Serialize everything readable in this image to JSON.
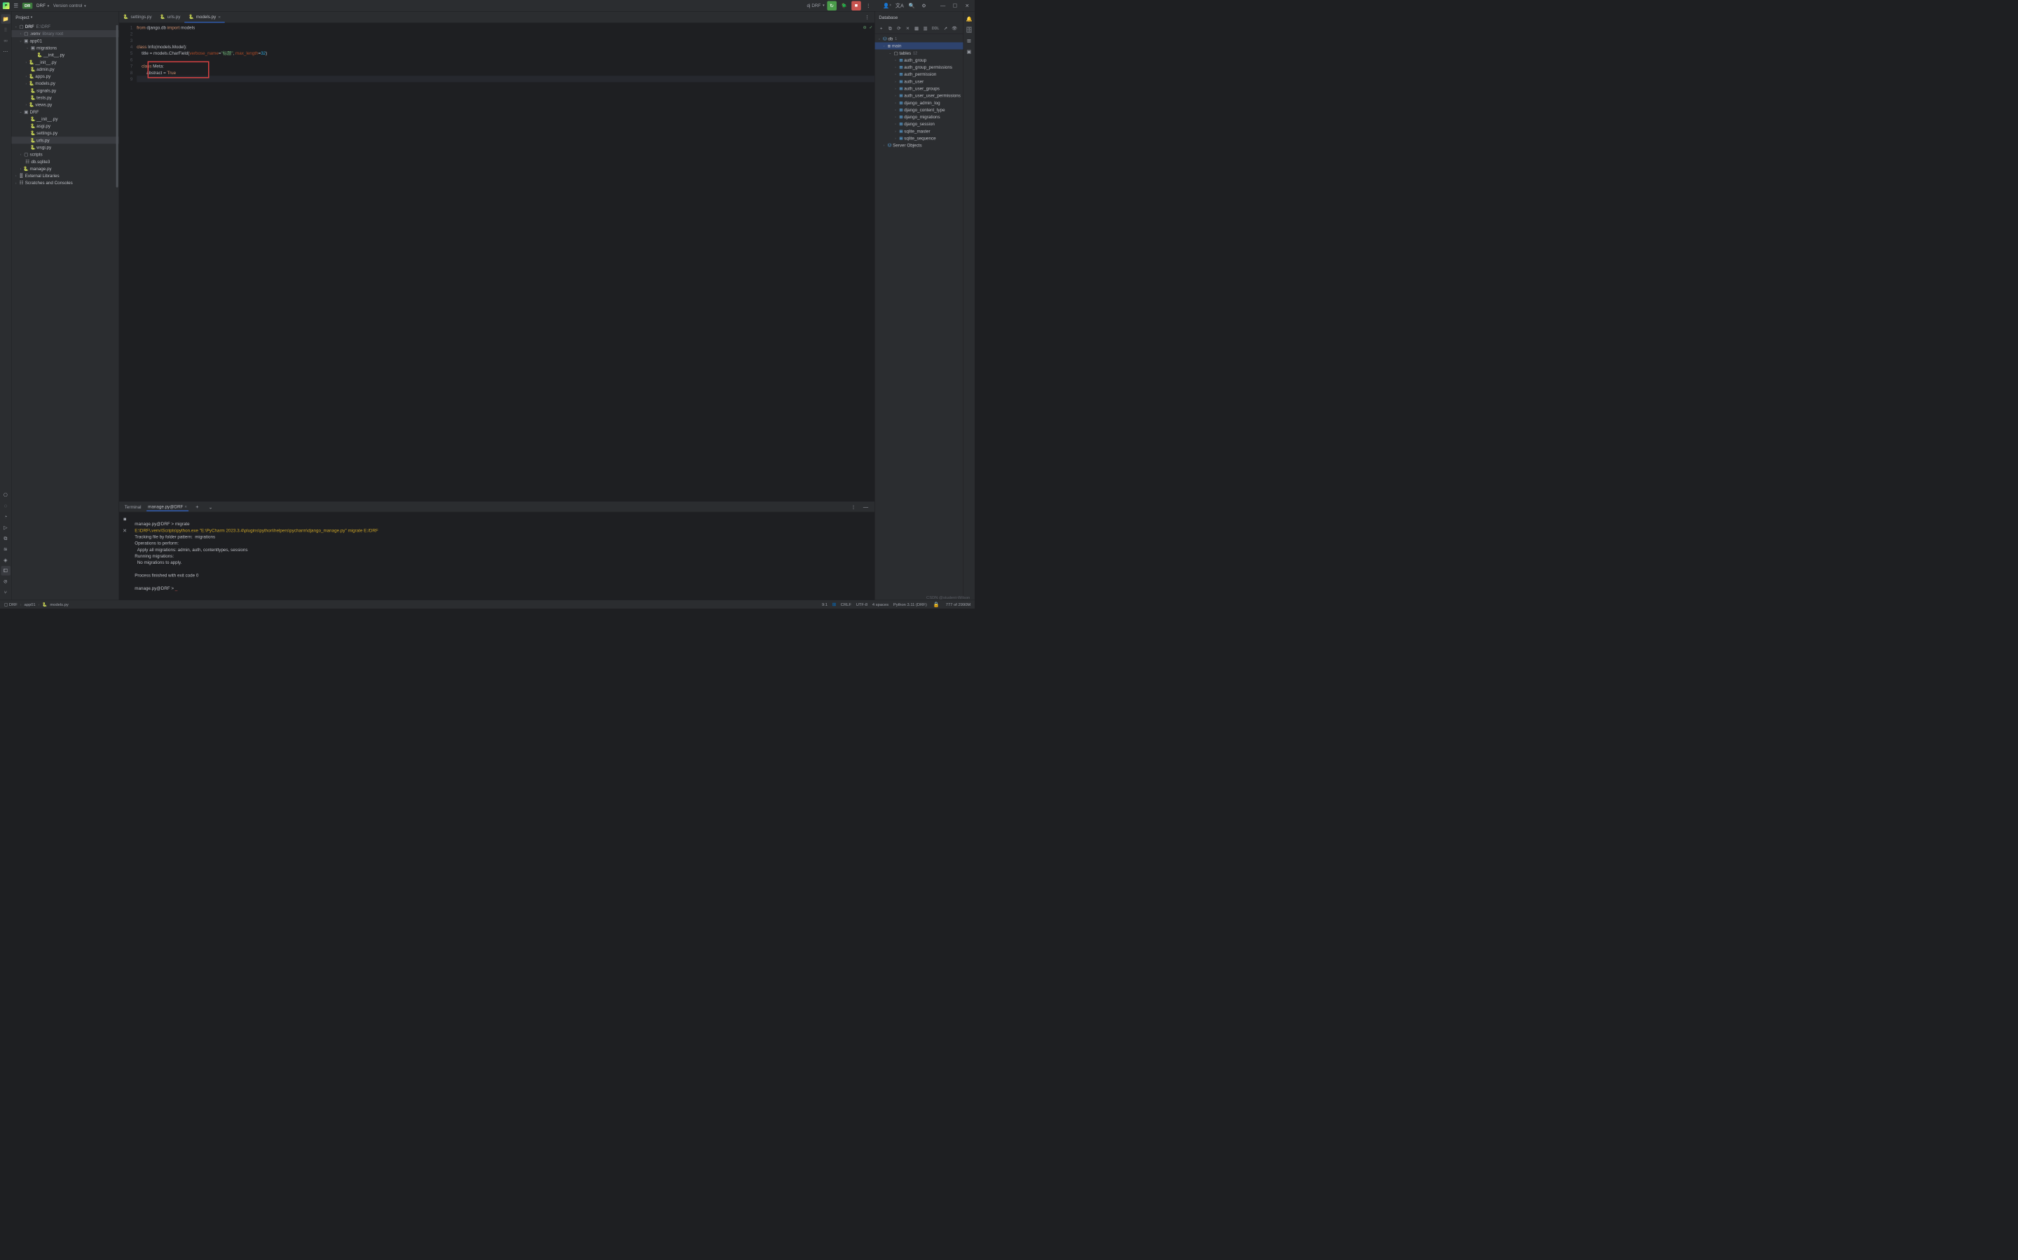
{
  "titlebar": {
    "project_badge": "DR",
    "project_name": "DRF",
    "vcs": "Version control",
    "run_config": "DRF"
  },
  "project_panel": {
    "title": "Project",
    "root": {
      "name": "DRF",
      "path": "E:\\DRF"
    },
    "venv": {
      "name": ".venv",
      "hint": "library root"
    },
    "app01": {
      "name": "app01",
      "migrations": "migrations",
      "init_in_migrations": "__init__.py",
      "files": {
        "init": "__init__.py",
        "admin": "admin.py",
        "apps": "apps.py",
        "models": "models.py",
        "signals": "signals.py",
        "tests": "tests.py",
        "views": "views.py"
      }
    },
    "drf": {
      "name": "DRF",
      "files": {
        "init": "__init__.py",
        "asgi": "asgi.py",
        "settings": "settings.py",
        "urls": "urls.py",
        "wsgi": "wsgi.py"
      }
    },
    "scripts": "scripts",
    "db": "db.sqlite3",
    "manage": "manage.py",
    "external": "External Libraries",
    "scratches": "Scratches and Consoles"
  },
  "tabs": {
    "settings": "settings.py",
    "urls": "urls.py",
    "models": "models.py"
  },
  "code": {
    "line1": {
      "from": "from",
      "mod": " django.db ",
      "import": "import",
      "models": " models"
    },
    "line4": {
      "class": "class",
      "name": " Info",
      "args": "(models.Model):"
    },
    "line5_pre": "    title = models.CharField(",
    "line5_vn": "verbose_name",
    "line5_eq1": "=",
    "line5_str": "\"标题\"",
    "line5_c": ", ",
    "line5_ml": "max_length",
    "line5_eq2": "=",
    "line5_num": "32",
    "line5_end": ")",
    "line7_pre": "    ",
    "line7_class": "class",
    "line7_rest": " Meta:",
    "line8_pre": "        abstract = ",
    "line8_true": "True"
  },
  "database": {
    "title": "Database",
    "ddl": "DDL",
    "db_name": "db",
    "db_count": "1",
    "main": "main",
    "tables": "tables",
    "tables_count": "12",
    "items": [
      "auth_group",
      "auth_group_permissions",
      "auth_permission",
      "auth_user",
      "auth_user_groups",
      "auth_user_user_permissions",
      "django_admin_log",
      "django_content_type",
      "django_migrations",
      "django_session",
      "sqlite_master",
      "sqlite_sequence"
    ],
    "server_objects": "Server Objects"
  },
  "terminal": {
    "tab1": "Terminal",
    "tab2": "manage.py@DRF",
    "lines": [
      "manage.py@DRF > migrate",
      "E:\\DRF\\.venv\\Scripts\\python.exe \"E:\\PyCharm 2023.3.4\\plugins\\python\\helpers\\pycharm\\django_manage.py\" migrate E:/DRF",
      "Tracking file by folder pattern:  migrations",
      "Operations to perform:",
      "  Apply all migrations: admin, auth, contenttypes, sessions",
      "Running migrations:",
      "  No migrations to apply.",
      "",
      "Process finished with exit code 0",
      "",
      "manage.py@DRF > "
    ]
  },
  "breadcrumbs": {
    "root": "DRF",
    "app": "app01",
    "file": "models.py"
  },
  "status": {
    "pos": "9:1",
    "crlf": "CRLF",
    "encoding": "UTF-8",
    "indent": "4 spaces",
    "python": "Python 3.11 (DRF)",
    "mem": "777 of 2990M"
  },
  "watermark": "CSDN @student-Wilson"
}
